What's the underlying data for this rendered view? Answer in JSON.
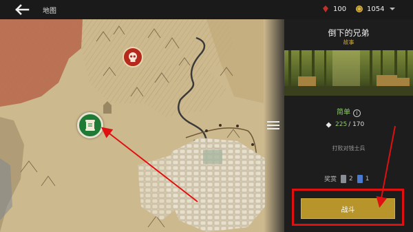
{
  "topbar": {
    "back_icon": "back-arrow-icon",
    "title": "地图",
    "gems": "100",
    "coins": "1054",
    "gem_color": "#c0302a",
    "coin_color": "#d8b445"
  },
  "panel": {
    "mission_title": "倒下的兄弟",
    "mission_subtitle": "故事",
    "difficulty": "简单",
    "power_current": "225",
    "power_required": "/ 170",
    "objective": "打败对钱士兵",
    "rewards_label": "奖赏",
    "reward_grey_count": "2",
    "reward_blue_count": "1",
    "battle_label": "战斗",
    "accent": "#b8952a",
    "difficulty_color": "#8ec96b"
  },
  "map": {
    "enemy_marker_icon": "skull-icon",
    "story_marker_icon": "scroll-icon",
    "menu_icon": "hamburger-menu-icon"
  },
  "annotations": {
    "color": "#e01010"
  }
}
